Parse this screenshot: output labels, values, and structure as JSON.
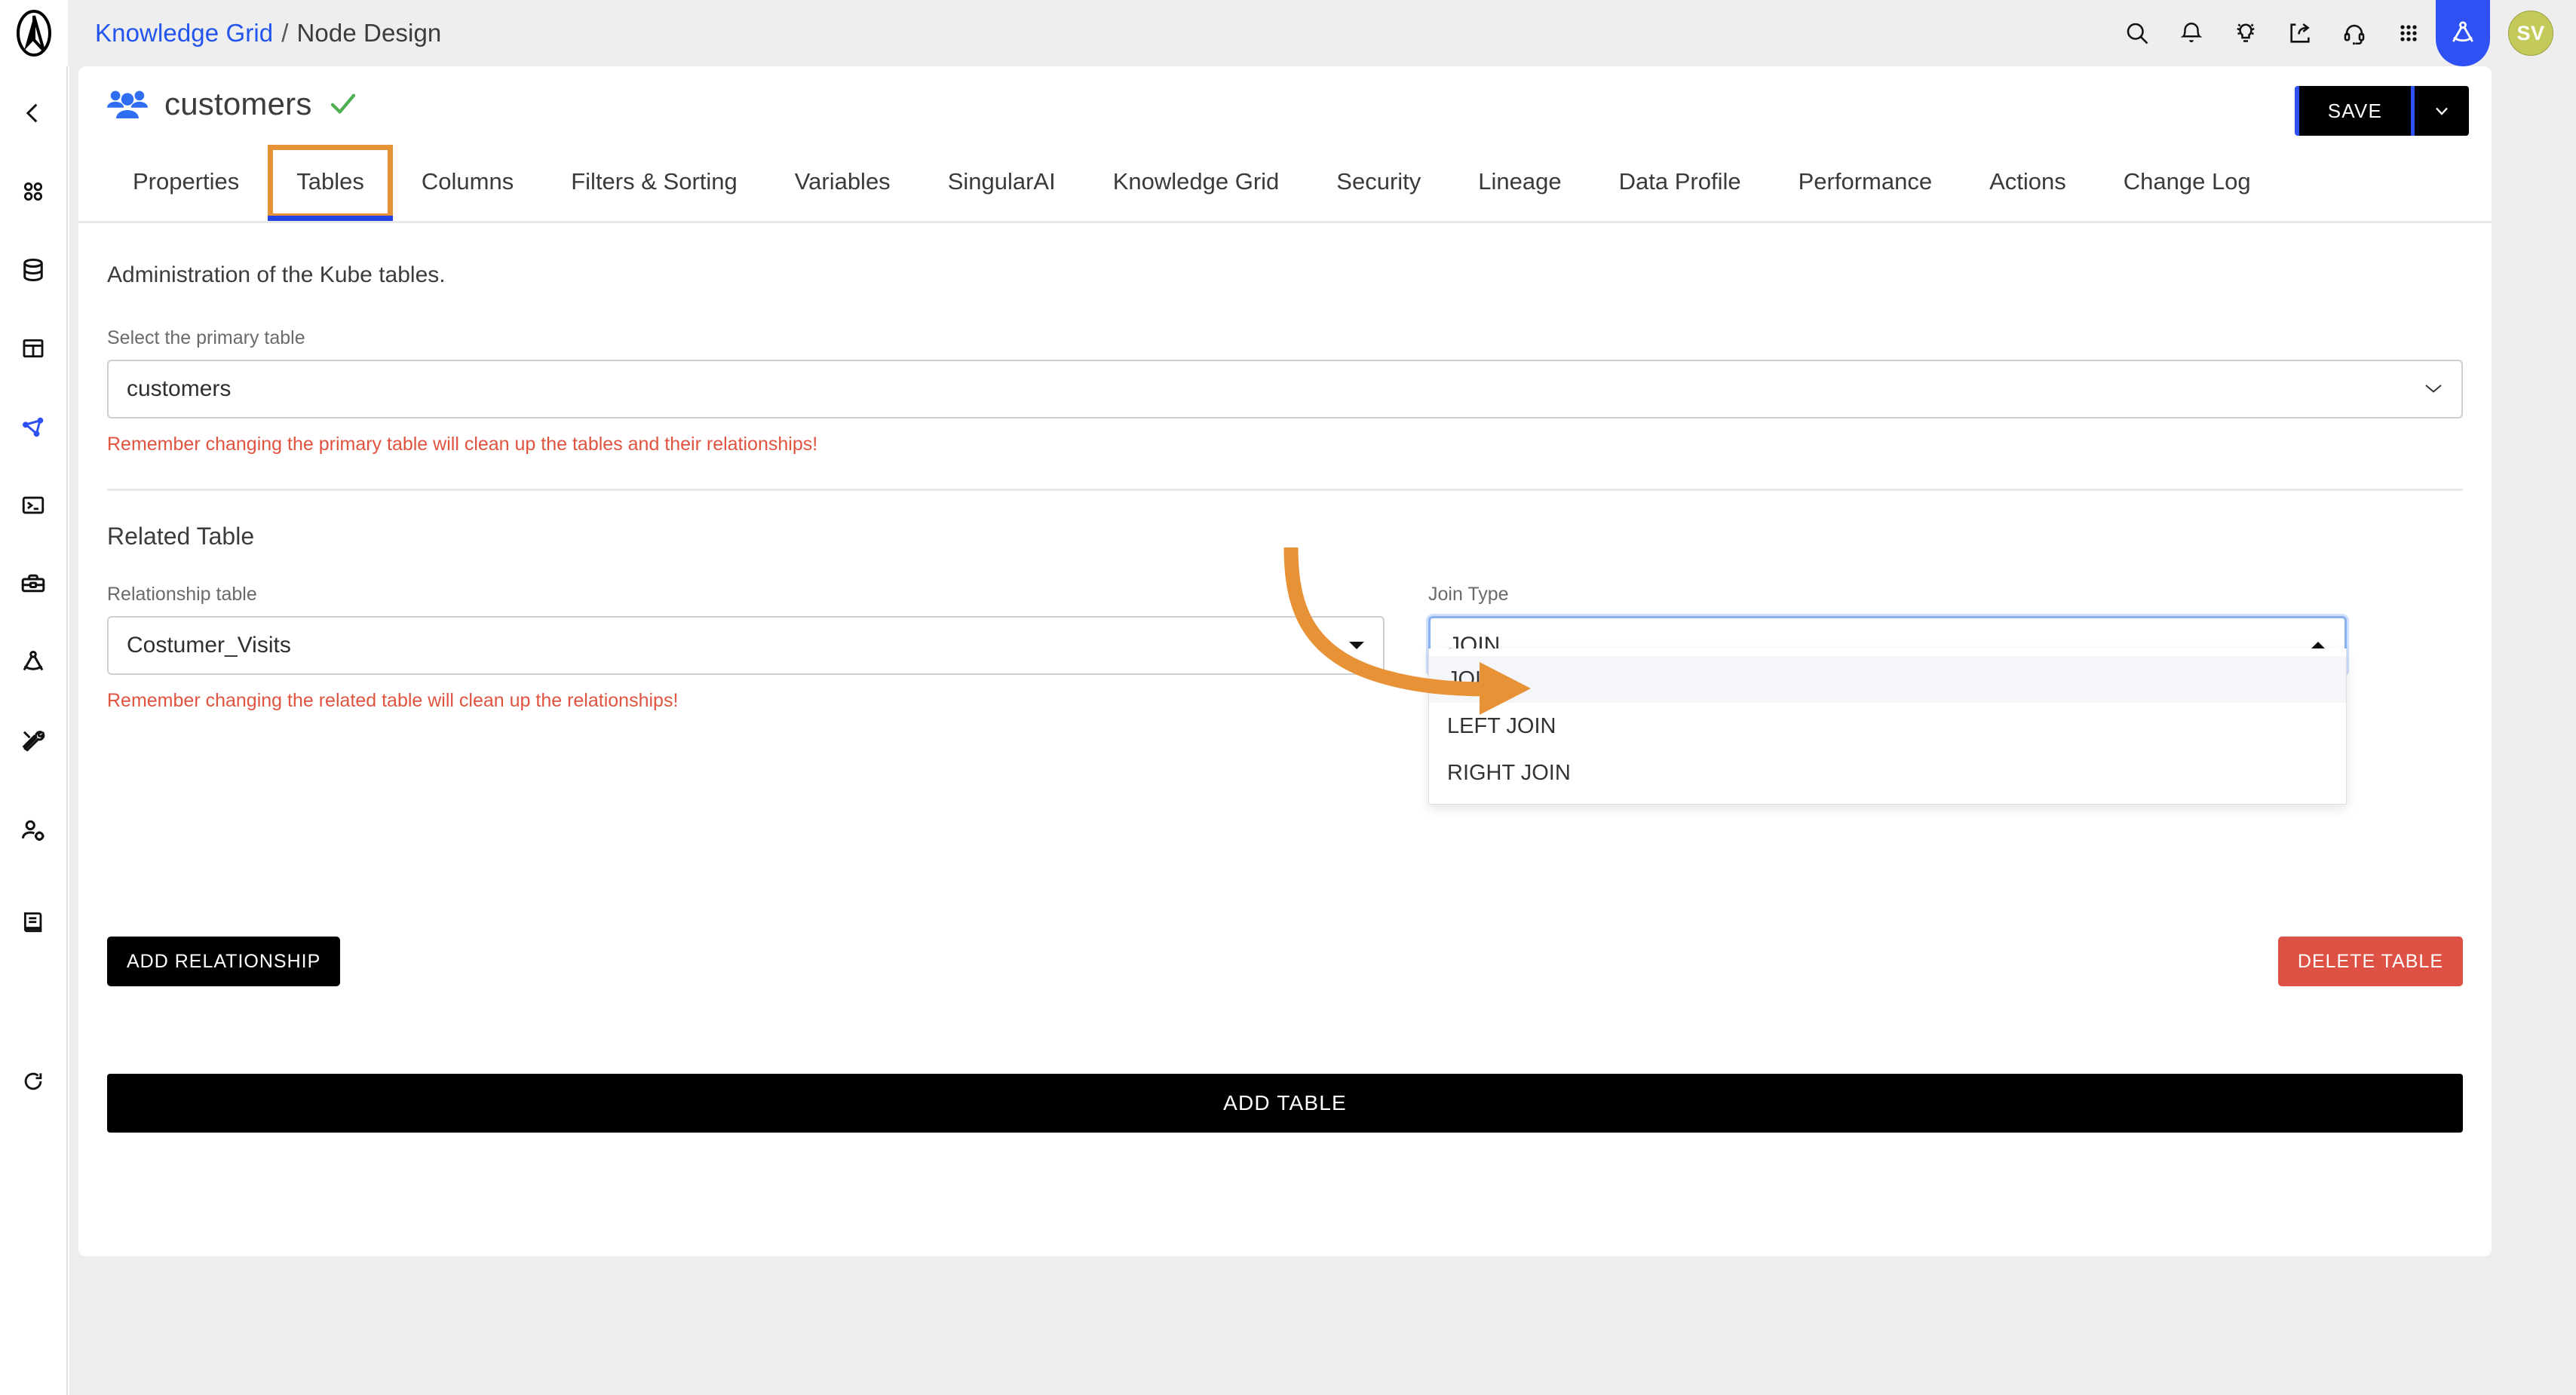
{
  "colors": {
    "accent_blue": "#2f51f3",
    "link_blue": "#2255ee",
    "annotation_orange": "#e89237",
    "warning_red": "#e0533f",
    "danger_red": "#dd5244",
    "check_green": "#4caf50",
    "avatar_olive": "#c3ca5a",
    "page_bg": "#ededed",
    "topbar_bg": "#eeeeee"
  },
  "topbar": {
    "logo_icon": "app-logo-icon",
    "breadcrumb": {
      "root": "Knowledge Grid",
      "separator": "/",
      "current": "Node Design"
    },
    "icons": [
      {
        "name": "search-icon",
        "glyph": "search"
      },
      {
        "name": "notifications-bell-icon",
        "glyph": "bell"
      },
      {
        "name": "insights-lightbulb-icon",
        "glyph": "bulb"
      },
      {
        "name": "share-export-icon",
        "glyph": "share"
      },
      {
        "name": "support-headset-icon",
        "glyph": "headset"
      },
      {
        "name": "apps-grid-icon",
        "glyph": "grid"
      },
      {
        "name": "designer-compass-icon",
        "glyph": "compass",
        "active": true
      }
    ],
    "avatar_initials": "SV"
  },
  "rail": {
    "items": [
      {
        "name": "collapse-sidebar-icon",
        "glyph": "chevron-left"
      },
      {
        "name": "dashboard-icon",
        "glyph": "dots-four"
      },
      {
        "name": "database-icon",
        "glyph": "database"
      },
      {
        "name": "tables-icon",
        "glyph": "table"
      },
      {
        "name": "node-graph-icon",
        "glyph": "graph",
        "active": true
      },
      {
        "name": "terminal-icon",
        "glyph": "terminal"
      },
      {
        "name": "toolbox-icon",
        "glyph": "briefcase"
      },
      {
        "name": "designer-compass-icon",
        "glyph": "compass"
      },
      {
        "name": "tools-icon",
        "glyph": "tools"
      },
      {
        "name": "user-settings-icon",
        "glyph": "user-gear"
      },
      {
        "name": "docs-book-icon",
        "glyph": "book"
      },
      {
        "name": "refresh-icon",
        "glyph": "refresh"
      }
    ]
  },
  "header": {
    "entity_icon": "people-group-icon",
    "title": "customers",
    "status_icon": "check-valid-icon",
    "save_label": "SAVE",
    "save_caret_icon": "chevron-down-icon"
  },
  "tabs": {
    "items": [
      {
        "label": "Properties"
      },
      {
        "label": "Tables",
        "active": true,
        "annotated": true
      },
      {
        "label": "Columns"
      },
      {
        "label": "Filters & Sorting"
      },
      {
        "label": "Variables"
      },
      {
        "label": "SingularAI"
      },
      {
        "label": "Knowledge Grid"
      },
      {
        "label": "Security"
      },
      {
        "label": "Lineage"
      },
      {
        "label": "Data Profile"
      },
      {
        "label": "Performance"
      },
      {
        "label": "Actions"
      },
      {
        "label": "Change Log"
      }
    ]
  },
  "main": {
    "intro": "Administration of the Kube tables.",
    "primary_table": {
      "label": "Select the primary table",
      "value": "customers",
      "caret_icon": "chevron-down-icon",
      "warning": "Remember changing the primary table will clean up the tables and their relationships!"
    },
    "related_table": {
      "section_title": "Related Table",
      "relationship": {
        "label": "Relationship table",
        "value": "Costumer_Visits",
        "caret_icon": "caret-down-icon",
        "warning": "Remember changing the related table will clean up the relationships!"
      },
      "join_type": {
        "label": "Join Type",
        "value": "JOIN",
        "caret_icon": "caret-up-icon",
        "open": true,
        "options": [
          {
            "label": "JOIN",
            "selected": true
          },
          {
            "label": "LEFT JOIN",
            "selected": false
          },
          {
            "label": "RIGHT JOIN",
            "selected": false
          }
        ]
      }
    },
    "buttons": {
      "add_relationship": "ADD RELATIONSHIP",
      "delete_table": "DELETE TABLE",
      "add_table": "ADD TABLE"
    }
  },
  "annotation": {
    "arrow_icon": "curved-arrow-annotation",
    "color": "#e89237",
    "points_to": "Join Type"
  }
}
